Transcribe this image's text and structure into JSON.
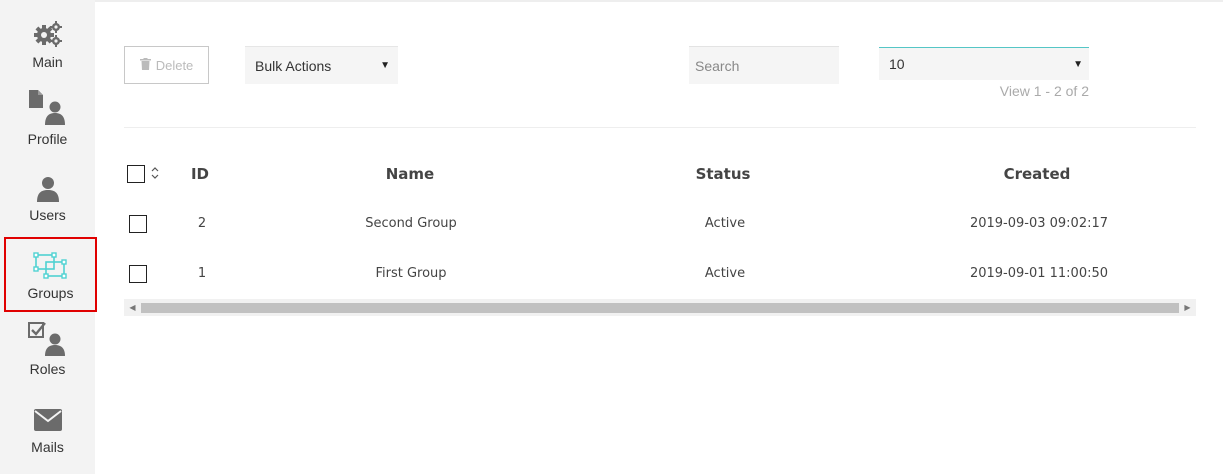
{
  "sidebar": {
    "items": [
      {
        "label": "Main",
        "icon": "gears-icon"
      },
      {
        "label": "Profile",
        "icon": "profile-icon"
      },
      {
        "label": "Users",
        "icon": "user-icon"
      },
      {
        "label": "Groups",
        "icon": "groups-icon",
        "active": true
      },
      {
        "label": "Roles",
        "icon": "roles-icon"
      },
      {
        "label": "Mails",
        "icon": "envelope-icon"
      }
    ]
  },
  "toolbar": {
    "delete_label": "Delete",
    "bulk_actions_label": "Bulk Actions",
    "search_placeholder": "Search",
    "per_page_value": "10",
    "view_count": "View 1 - 2 of 2"
  },
  "table": {
    "headers": [
      "ID",
      "Name",
      "Status",
      "Created"
    ],
    "rows": [
      {
        "id": "2",
        "name": "Second Group",
        "status": "Active",
        "created": "2019-09-03 09:02:17"
      },
      {
        "id": "1",
        "name": "First Group",
        "status": "Active",
        "created": "2019-09-01 11:00:50"
      }
    ]
  },
  "colors": {
    "active_border": "#e00000",
    "icon_gray": "#6b6b6b",
    "icon_active": "#4fd2d2",
    "select_accent": "#55c6c6"
  }
}
